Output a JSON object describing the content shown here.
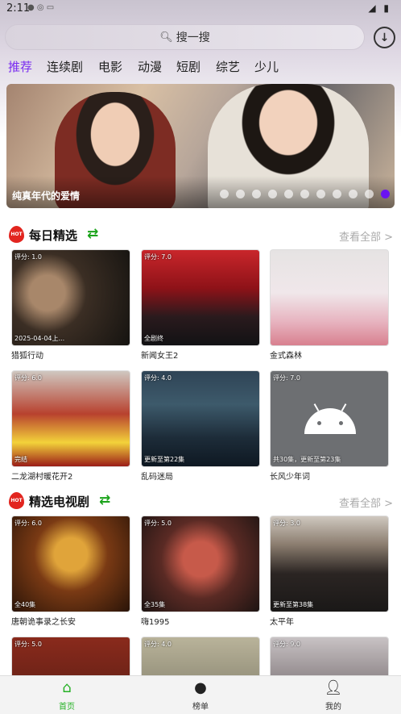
{
  "status": {
    "time": "2:11",
    "left_icons": "● ◎ ▭",
    "right_icons": "◢ ▮"
  },
  "search": {
    "placeholder": "搜一搜",
    "icon": "search-icon"
  },
  "download": {
    "icon": "download-icon"
  },
  "tabs": [
    "推荐",
    "连续剧",
    "电影",
    "动漫",
    "短剧",
    "综艺",
    "少儿"
  ],
  "active_tab": 0,
  "banner": {
    "caption": "纯真年代的爱情",
    "dot_count": 11,
    "active_dot": 10
  },
  "sections": [
    {
      "title": "每日精选",
      "more": "查看全部 >",
      "cards": [
        {
          "rating": "评分: 1.0",
          "badge": "2025-04-04上...",
          "title": "猎狐行动"
        },
        {
          "rating": "评分: 7.0",
          "badge": "全剧终",
          "title": "新闻女王2"
        },
        {
          "rating": "",
          "badge": "",
          "title": "金式森林"
        },
        {
          "rating": "评分: 6.0",
          "badge": "完结",
          "title": "二龙湖村暖花开2"
        },
        {
          "rating": "评分: 4.0",
          "badge": "更新至第22集",
          "title": "乱码迷局"
        },
        {
          "rating": "评分: 7.0",
          "badge": "共30集，更新至第23集",
          "title": "长风少年词"
        }
      ]
    },
    {
      "title": "精选电视剧",
      "more": "查看全部 >",
      "cards": [
        {
          "rating": "评分: 6.0",
          "badge": "全40集",
          "title": "唐朝诡事录之长安"
        },
        {
          "rating": "评分: 5.0",
          "badge": "全35集",
          "title": "嗨1995"
        },
        {
          "rating": "评分: 3.0",
          "badge": "更新至第38集",
          "title": "太平年"
        },
        {
          "rating": "评分: 5.0",
          "badge": "",
          "title": ""
        },
        {
          "rating": "评分: 4.0",
          "badge": "",
          "title": ""
        },
        {
          "rating": "评分: 9.0",
          "badge": "",
          "title": ""
        }
      ]
    }
  ],
  "bottom_nav": [
    {
      "label": "首页",
      "icon": "home-icon"
    },
    {
      "label": "榜单",
      "icon": "flame-icon"
    },
    {
      "label": "我的",
      "icon": "user-icon"
    }
  ],
  "colors": {
    "accent": "#7a2cf0",
    "nav_active": "#25b125",
    "hot": "#e2251f"
  }
}
